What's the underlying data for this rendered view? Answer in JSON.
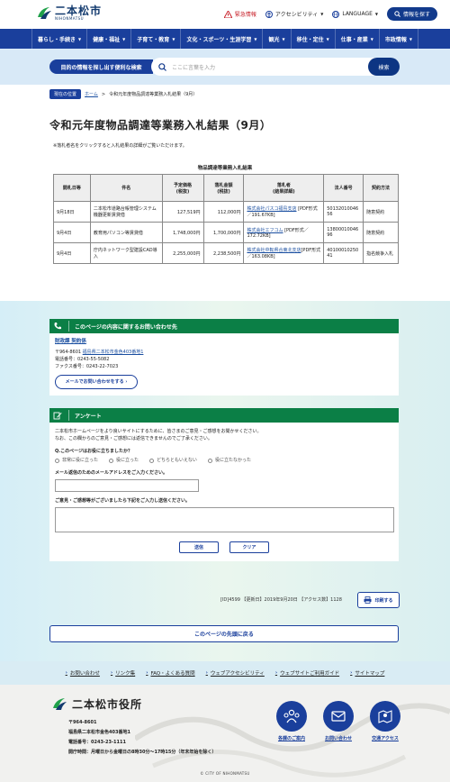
{
  "header": {
    "logo_ja": "二本松市",
    "logo_en": "NIHONMATSU",
    "emergency": "緊急情報",
    "accessibility": "アクセシビリティ",
    "language": "LANGUAGE",
    "find_info": "情報を探す"
  },
  "nav": [
    "暮らし・手続き",
    "健康・福祉",
    "子育て・教育",
    "文化・スポーツ・生涯学習",
    "観光",
    "移住・定住",
    "仕事・産業",
    "市政情報"
  ],
  "search": {
    "label": "目的の情報を探し出す便利な検索",
    "placeholder": "ここに言葉を入力",
    "button": "検索"
  },
  "breadcrumb": {
    "tag": "現在の位置",
    "home": "ホーム",
    "sep": ">",
    "current": "令和元年度物品調達等業務入札結果（9月）"
  },
  "page": {
    "title": "令和元年度物品調達等業務入札結果（9月）",
    "note": "※落札者名をクリックすると入札結果の詳細がご覧いただけます。",
    "table_caption": "物品調達等業務入札結果"
  },
  "table": {
    "headers": [
      "開札日等",
      "件名",
      "予定価格\n(税抜)",
      "落札金額\n(税抜)",
      "落札者\n(結果詳細)",
      "法人番号",
      "契約方法"
    ],
    "rows": [
      {
        "date": "9月18日",
        "subject": "二本松市道路台帳管理システム機器更新賃貸借",
        "estimate": "127,519円",
        "award": "112,000円",
        "winner_link": "株式会社パスコ福島支店",
        "winner_file": " [PDF形式／191.67KB]",
        "corp_no": "5013201004656",
        "method": "随意契約"
      },
      {
        "date": "9月4日",
        "subject": "教育用パソコン等賃貸借",
        "estimate": "1,748,000円",
        "award": "1,700,000円",
        "winner_link": "株式会社エフコム",
        "winner_file": " [PDF形式／172.72KB]",
        "corp_no": "1380001004696",
        "method": "随意契約"
      },
      {
        "date": "9月4日",
        "subject": "庁内ネットワーク型建設CAD導入",
        "estimate": "2,255,000円",
        "award": "2,238,500円",
        "winner_link": "株式会社中転県合東北支店",
        "winner_file": "[PDF形式／163.08KB]",
        "corp_no": "4010001025041",
        "method": "指名競争入札"
      }
    ]
  },
  "contact": {
    "heading": "このページの内容に関するお問い合わせ先",
    "dept": "財政課 契約係",
    "address_prefix": "〒964-8601 ",
    "address_link": "福島県二本松市金色403番地1",
    "tel": "電話番号：0243-55-5082",
    "fax": "ファクス番号：0243-22-7023",
    "mail_button": "メールでお問い合わせをする"
  },
  "survey": {
    "heading": "アンケート",
    "intro1": "二本松市ホームページをより良いサイトにするために、皆さまのご意見・ご感想をお聞かせください。",
    "intro2": "なお、この欄からのご意見・ご感想には返信できませんのでご了承ください。",
    "question": "Q.このページはお役に立ちましたか？",
    "options": [
      "非常に役に立った",
      "役に立った",
      "どちらともいえない",
      "役に立たなかった"
    ],
    "email_label": "メール返信のためのメールアドレスをご入力ください。",
    "comment_label": "ご意見・ご感想等がございましたら下記をご入力し送信ください。",
    "submit": "送信",
    "clear": "クリア"
  },
  "meta": {
    "text": "[ID]4599 【更新日】2019年9月20日 【アクセス数】1128",
    "print": "印刷する",
    "to_top": "このページの先頭に戻る"
  },
  "footer_links": [
    "お問い合わせ",
    "リンク集",
    "FAQ・よくある質問",
    "ウェブアクセシビリティ",
    "ウェブサイトご利用ガイド",
    "サイトマップ"
  ],
  "footer": {
    "name": "二本松市役所",
    "zip": "〒964-8601",
    "address": "福島県二本松市金色403番地1",
    "tel": "電話番号：0243-23-1111",
    "hours": "開庁時間：月曜日から金曜日の8時30分～17時15分（年末年始を除く）",
    "icons": [
      "各課のご案内",
      "お問い合わせ",
      "交通アクセス"
    ],
    "copyright": "© CITY OF NIHONMATSU"
  },
  "colors": {
    "nav": "#1a3f9c",
    "accent_green": "#0b7f46",
    "emergency": "#c8222b"
  }
}
